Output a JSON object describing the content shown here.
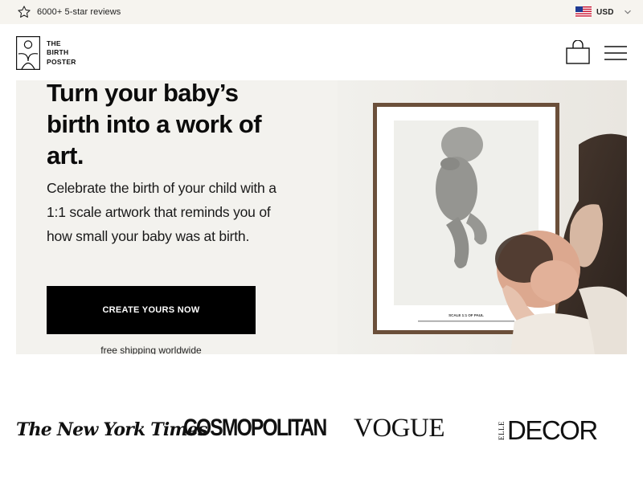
{
  "announcement": {
    "star_icon": "star-outline-icon",
    "reviews_text": "6000+ 5-star reviews",
    "currency_code": "USD",
    "flag_icon": "us-flag-icon",
    "chevron_icon": "chevron-down-icon"
  },
  "header": {
    "logo_lines": [
      "THE",
      "BIRTH",
      "POSTER"
    ],
    "cart_icon": "shopping-bag-icon",
    "menu_icon": "hamburger-menu-icon"
  },
  "hero": {
    "title": "Turn your baby’s birth into a work of art.",
    "subtitle": "Celebrate the birth of your child with a 1:1 scale artwork that reminds you of how small your baby was at birth.",
    "cta_label": "CREATE YOURS NOW",
    "shipping_note": "free shipping worldwide",
    "poster_caption": "SCALE 1:1 OF PAUL"
  },
  "press": {
    "logos": [
      "The New York Times",
      "COSMOPOLITAN",
      "VOGUE",
      "ELLE",
      "DECOR"
    ]
  },
  "colors": {
    "topbar_bg": "#f6f4ef",
    "hero_bg": "#f3f2ee",
    "cta_bg": "#000000",
    "cta_text": "#ffffff"
  }
}
